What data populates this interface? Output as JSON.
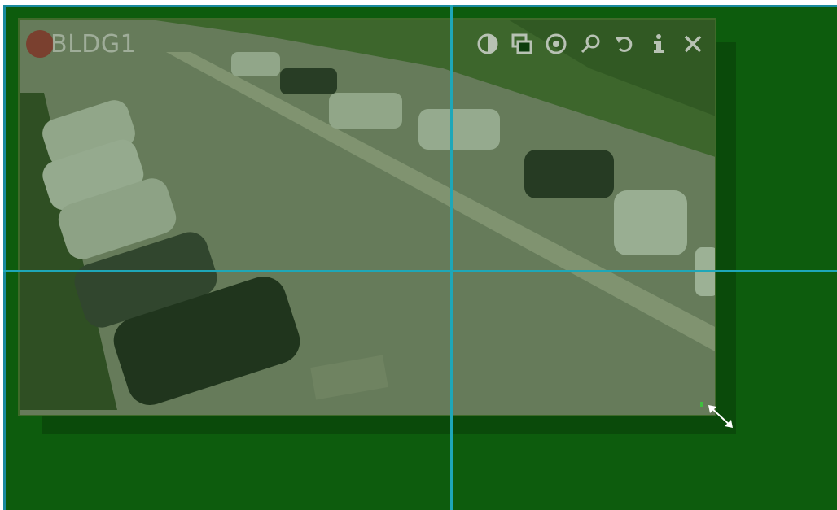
{
  "camera": {
    "name": "BLDG1",
    "recording_color": "#7c3a2a"
  },
  "toolbar": {
    "buttons": [
      {
        "name": "contrast-icon",
        "label": "contrast"
      },
      {
        "name": "pip-icon",
        "label": "picture-in-picture"
      },
      {
        "name": "target-icon",
        "label": "center"
      },
      {
        "name": "zoom-icon",
        "label": "zoom"
      },
      {
        "name": "refresh-icon",
        "label": "refresh"
      },
      {
        "name": "info-icon",
        "label": "info"
      },
      {
        "name": "close-icon",
        "label": "close"
      }
    ]
  },
  "colors": {
    "background": "#0d5c0d",
    "gridline": "#1ea7b8",
    "icon": "#b8c2b4"
  }
}
